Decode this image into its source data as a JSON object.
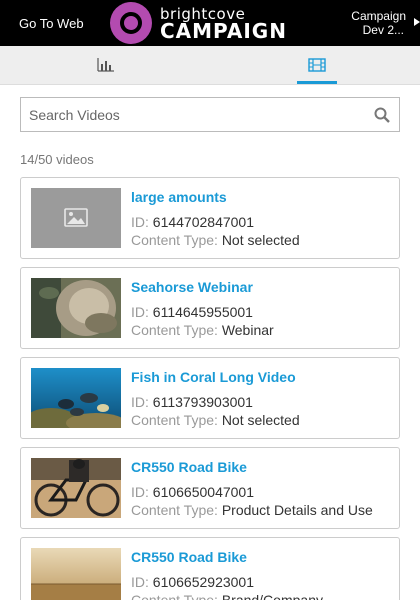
{
  "header": {
    "goto_label": "Go To Web",
    "logo_small": "brightcove",
    "logo_big": "CAMPAIGN",
    "campaign_line1": "Campaign",
    "campaign_line2": "Dev 2...",
    "brand_color": "#b34bb0"
  },
  "tabs": [
    {
      "icon": "bar-chart-icon",
      "active": false
    },
    {
      "icon": "film-icon",
      "active": true
    }
  ],
  "accent_color": "#1a9ad6",
  "search": {
    "placeholder": "Search Videos"
  },
  "video_count": "14/50 videos",
  "labels": {
    "id": "ID:",
    "content_type": "Content Type:"
  },
  "videos": [
    {
      "title": "large amounts",
      "id": "6144702847001",
      "content_type": "Not selected",
      "thumb": "placeholder-image-icon"
    },
    {
      "title": "Seahorse Webinar",
      "id": "6114645955001",
      "content_type": "Webinar",
      "thumb": "seahorse"
    },
    {
      "title": "Fish in Coral Long Video",
      "id": "6113793903001",
      "content_type": "Not selected",
      "thumb": "coral-fish"
    },
    {
      "title": "CR550 Road Bike",
      "id": "6106650047001",
      "content_type": "Product Details and Use",
      "thumb": "road-bike-cyclist"
    },
    {
      "title": "CR550 Road Bike",
      "id": "6106652923001",
      "content_type": "Brand/Company",
      "thumb": "road-bike-desert"
    }
  ]
}
